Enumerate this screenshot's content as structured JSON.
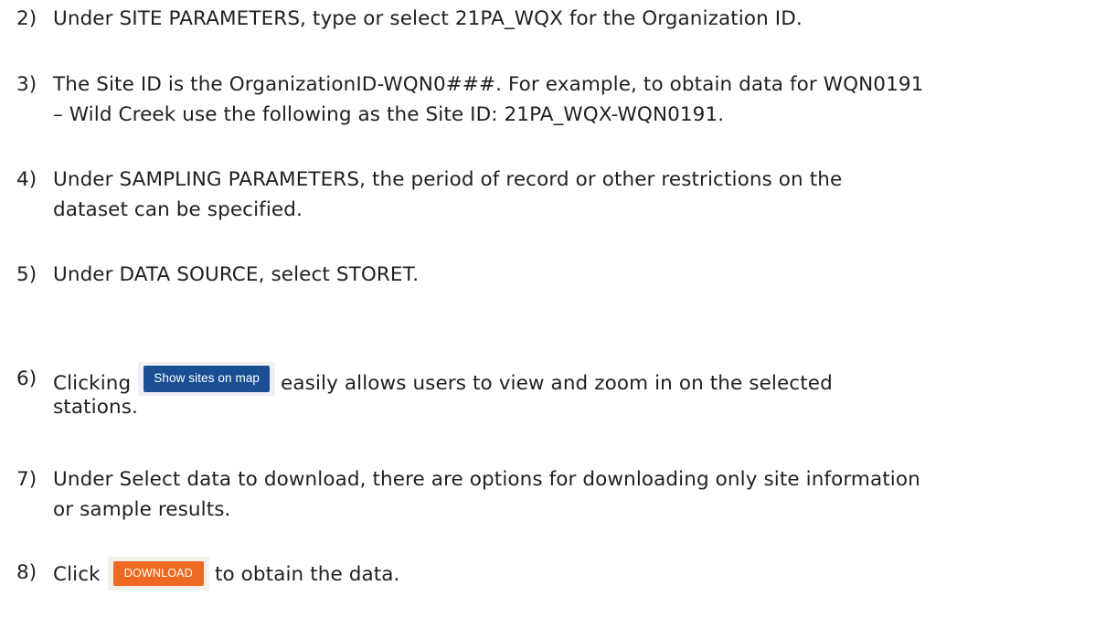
{
  "steps": [
    {
      "number": "2)",
      "lines": [
        "Under SITE PARAMETERS, type or select 21PA_WQX for the Organization ID."
      ]
    },
    {
      "number": "3)",
      "lines": [
        "The Site ID is the OrganizationID-WQN0###.  For example, to obtain data for WQN0191",
        "– Wild Creek use the following as the Site ID: 21PA_WQX-WQN0191."
      ]
    },
    {
      "number": "4)",
      "lines": [
        "Under SAMPLING PARAMETERS, the period of record or other restrictions on the",
        "dataset can be specified."
      ]
    },
    {
      "number": "5)",
      "lines": [
        "Under DATA SOURCE, select STORET."
      ]
    },
    {
      "number": "6)",
      "before": "Clicking",
      "button": "Show sites on map",
      "after": "easily allows users to view and zoom in on the selected",
      "line2": "stations."
    },
    {
      "number": "7)",
      "lines": [
        "Under Select data to download, there are options for downloading only site information",
        "or sample results."
      ]
    },
    {
      "number": "8)",
      "before": "Click",
      "button": "DOWNLOAD",
      "after": "to obtain the data."
    }
  ],
  "colors": {
    "show_sites_button": "#1b4f93",
    "download_button": "#ee6a22",
    "text": "#1f1f1f"
  }
}
